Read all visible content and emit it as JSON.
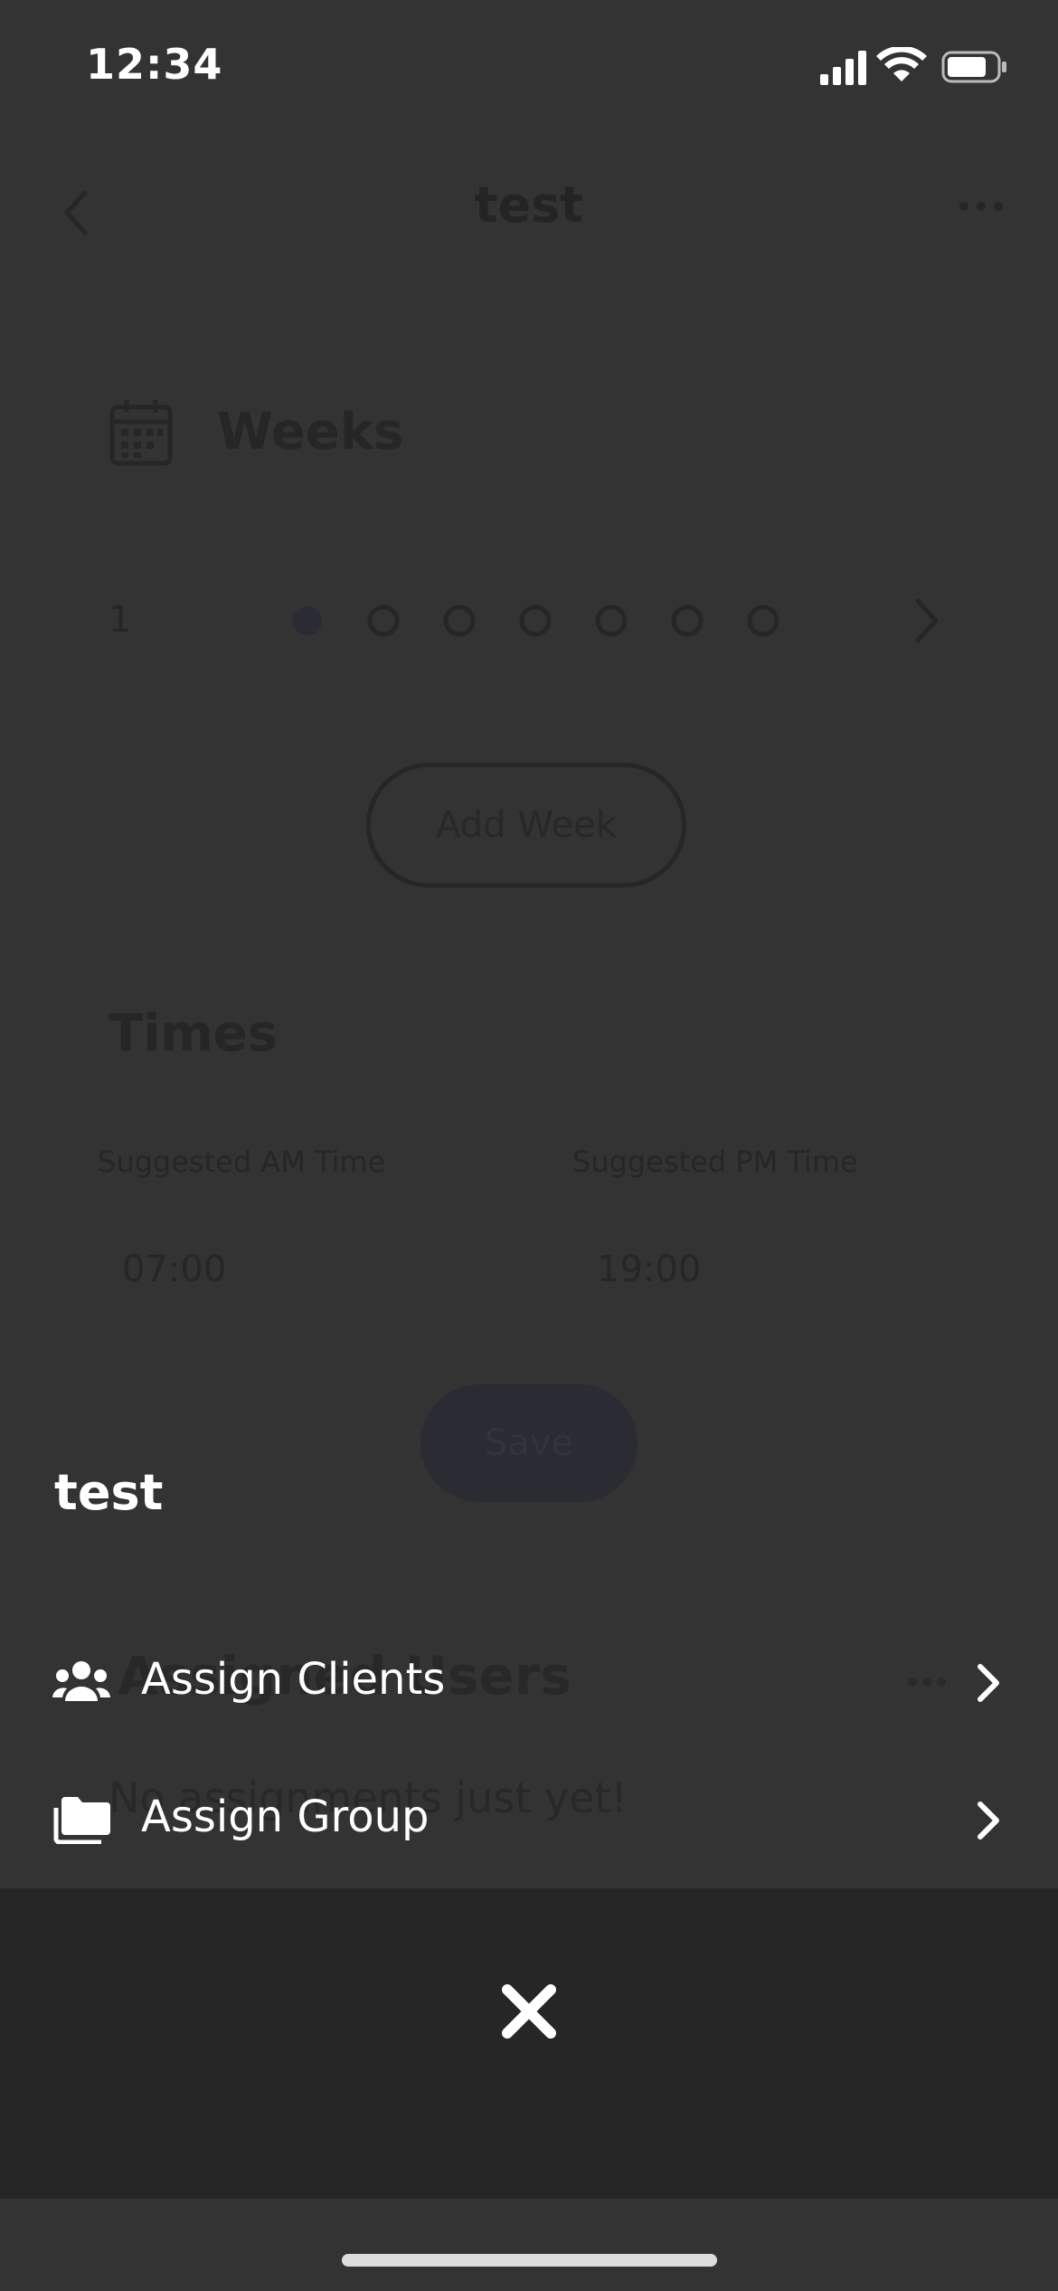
{
  "status_bar": {
    "time": "12:34"
  },
  "nav": {
    "title": "test"
  },
  "weeks": {
    "title": "Weeks",
    "current_week": "1",
    "total_dots": 7,
    "active_dot": 1,
    "add_week_label": "Add Week"
  },
  "times": {
    "title": "Times",
    "am_label": "Suggested AM Time",
    "am_value": "07:00",
    "pm_label": "Suggested PM Time",
    "pm_value": "19:00",
    "save_label": "Save"
  },
  "assigned": {
    "title": "Assigned Users",
    "empty_text": "No assignments just yet!"
  },
  "sheet": {
    "title": "test",
    "items": [
      {
        "label": "Assign Clients",
        "icon": "users-icon"
      },
      {
        "label": "Assign Group",
        "icon": "folder-icon"
      }
    ],
    "close_icon": "close-icon"
  },
  "colors": {
    "overlay_bg": "#333333",
    "close_panel_bg": "#262626",
    "text": "#ffffff"
  }
}
